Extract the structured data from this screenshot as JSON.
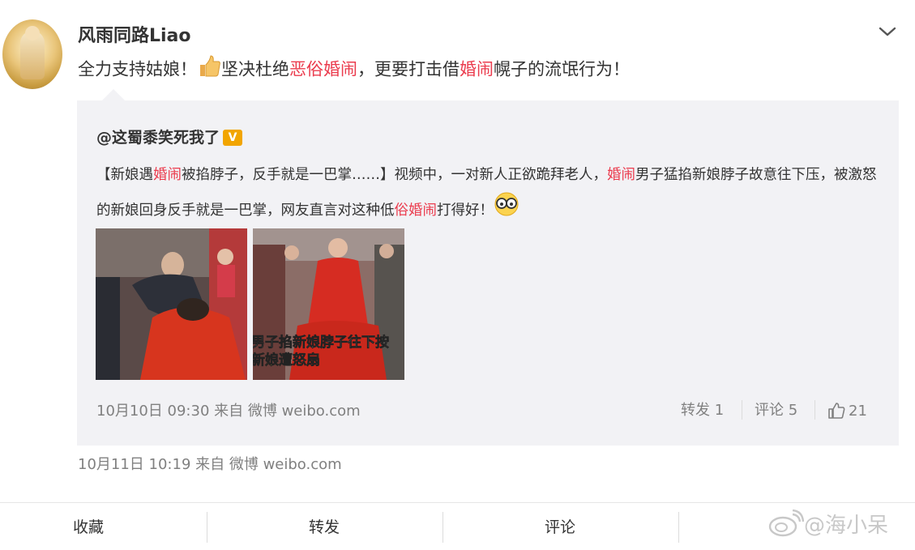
{
  "post": {
    "username": "风雨同路Liao",
    "text_parts": [
      "全力支持姑娘！",
      "坚决杜绝",
      "恶俗婚闹",
      "，更要打击借",
      "婚闹",
      "幌子的流氓行为！"
    ],
    "timestamp": "10月11日 10:19 来自 微博 weibo.com"
  },
  "repost": {
    "username": "@这蜀黍笑死我了",
    "badge": "V",
    "text_parts": [
      "【新娘遇",
      "婚闹",
      "被掐脖子，反手就是一巴掌……】视频中，一对新人正欲跪拜老人，",
      "婚闹",
      "男子猛掐新娘脖子故意往下压，被激怒的新娘回身反手就是一巴掌，网友直言对这种低",
      "俗婚闹",
      "打得好！"
    ],
    "images": [
      {
        "caption": ""
      },
      {
        "caption_line1": "男子掐新娘脖子往下按",
        "caption_line2": "新娘遭怒扇"
      }
    ],
    "timestamp": "10月10日 09:30 来自 微博 weibo.com",
    "repost_label": "转发 1",
    "comment_label": "评论 5",
    "like_count": "21"
  },
  "bottom_bar": {
    "favorite": "收藏",
    "repost": "转发",
    "comment": "评论"
  },
  "watermark": "@海小呆",
  "colors": {
    "highlight": "#eb3c4e",
    "panel": "#f2f2f5",
    "muted": "#808080"
  },
  "icons": [
    "chevron-down-icon",
    "thumbs-up-emoji",
    "verified-badge-icon",
    "glasses-emoji",
    "like-icon",
    "weibo-logo-icon"
  ]
}
